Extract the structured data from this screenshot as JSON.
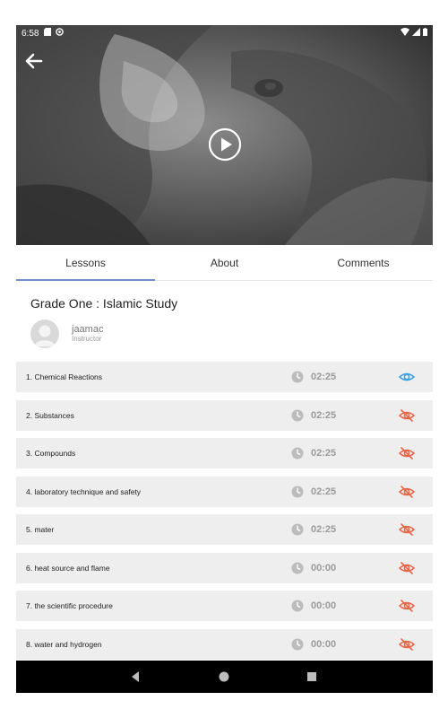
{
  "status_bar": {
    "time": "6:58",
    "icons": [
      "sd-card-icon",
      "sync-icon"
    ],
    "right_icons": [
      "wifi-icon",
      "signal-icon",
      "battery-icon"
    ]
  },
  "video": {
    "thumbnail": "lion-close-up-grayscale",
    "back_icon": "back-arrow-icon",
    "play_icon": "play-icon"
  },
  "tabs": [
    {
      "label": "Lessons",
      "active": true
    },
    {
      "label": "About",
      "active": false
    },
    {
      "label": "Comments",
      "active": false
    }
  ],
  "course": {
    "title": "Grade One : Islamic Study"
  },
  "instructor": {
    "name": "jaamac",
    "role": "Instructor"
  },
  "lessons": [
    {
      "title": "1. Chemical Reactions",
      "duration": "02:25",
      "visible": true
    },
    {
      "title": "2. Substances",
      "duration": "02:25",
      "visible": false
    },
    {
      "title": "3. Compounds",
      "duration": "02:25",
      "visible": false
    },
    {
      "title": "4. laboratory technique and safety",
      "duration": "02:25",
      "visible": false
    },
    {
      "title": "5. mater",
      "duration": "02:25",
      "visible": false
    },
    {
      "title": "6. heat source and flame",
      "duration": "00:00",
      "visible": false
    },
    {
      "title": "7. the scientific procedure",
      "duration": "00:00",
      "visible": false
    },
    {
      "title": "8. water and hydrogen",
      "duration": "00:00",
      "visible": false
    }
  ],
  "colors": {
    "accent": "#6f8fc9",
    "eye_visible": "#3aa0e0",
    "eye_hidden": "#e8664a",
    "row_bg": "#eeeeee",
    "duration_text": "#9a9a9a"
  },
  "nav_bar": [
    "back-triangle-icon",
    "home-circle-icon",
    "recents-square-icon"
  ]
}
